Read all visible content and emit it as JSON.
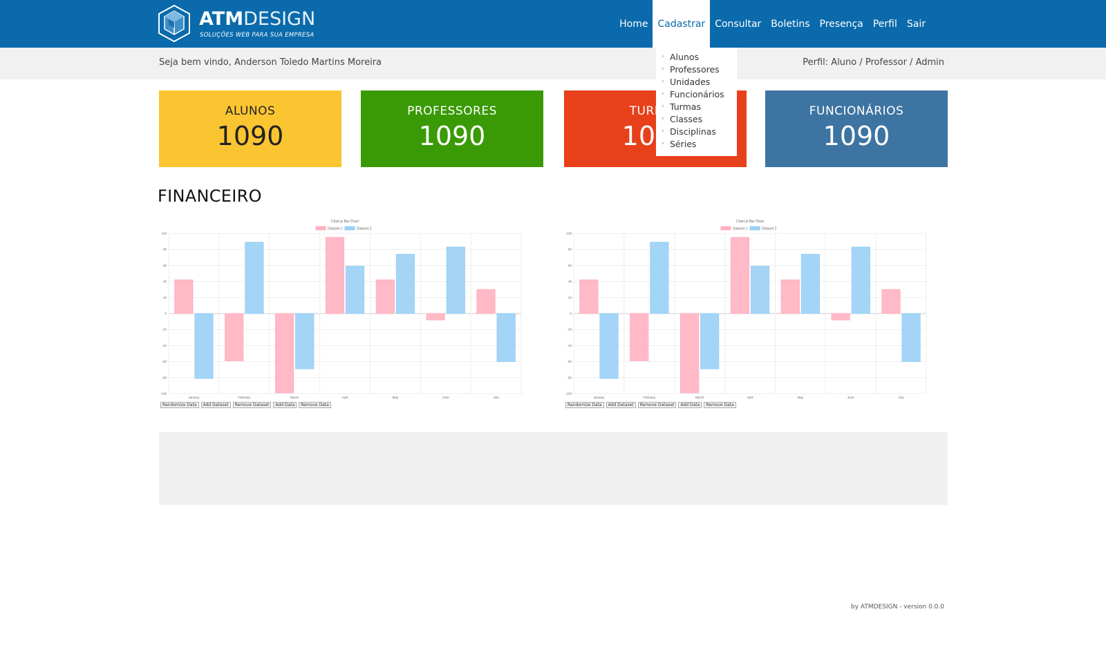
{
  "header": {
    "logo_bold": "ATM",
    "logo_light": "DESIGN",
    "logo_tagline": "SOLUÇÕES WEB PARA SUA EMPRESA",
    "nav": [
      {
        "label": "Home"
      },
      {
        "label": "Cadastrar"
      },
      {
        "label": "Consultar"
      },
      {
        "label": "Boletins"
      },
      {
        "label": "Presença"
      },
      {
        "label": "Perfil"
      },
      {
        "label": "Sair"
      }
    ],
    "colors": {
      "bar": "#0a6aab"
    }
  },
  "dropdown": {
    "items": [
      "Alunos",
      "Professores",
      "Unidades",
      "Funcionários",
      "Turmas",
      "Classes",
      "Disciplinas",
      "Séries"
    ]
  },
  "welcome": {
    "text": "Seja bem vindo, Anderson Toledo Martins Moreira",
    "profile": "Perfil: Aluno / Professor / Admin"
  },
  "cards": [
    {
      "label": "ALUNOS",
      "value": "1090",
      "color": "#fbc532"
    },
    {
      "label": "PROFESSORES",
      "value": "1090",
      "color": "#3a9a05"
    },
    {
      "label": "TURMAS",
      "value": "1090",
      "color": "#e8401a"
    },
    {
      "label": "FUNCIONÁRIOS",
      "value": "1090",
      "color": "#3e74a2"
    }
  ],
  "section_title": "FINANCEIRO",
  "chart_buttons": [
    "Randomize Data",
    "Add Dataset",
    "Remove Dataset",
    "Add Data",
    "Remove Data"
  ],
  "chart_data": [
    {
      "type": "bar",
      "title": "Chart.js Bar Chart",
      "categories": [
        "January",
        "February",
        "March",
        "April",
        "May",
        "June",
        "July"
      ],
      "series": [
        {
          "name": "Dataset 1",
          "color": "#ffb1c1",
          "values": [
            42,
            -59,
            -99,
            95,
            42,
            -8,
            30
          ]
        },
        {
          "name": "Dataset 2",
          "color": "#9ad0f5",
          "values": [
            -81,
            89,
            -69,
            59,
            74,
            83,
            -60
          ]
        }
      ],
      "ylim": [
        -100,
        100
      ],
      "yticks": [
        "100",
        "80",
        "60",
        "40",
        "20",
        "0",
        "-20",
        "-40",
        "-60",
        "-80",
        "-100"
      ],
      "legend": "top"
    },
    {
      "type": "bar",
      "title": "Chart.js Bar Chart",
      "categories": [
        "January",
        "February",
        "March",
        "April",
        "May",
        "June",
        "July"
      ],
      "series": [
        {
          "name": "Dataset 1",
          "color": "#ffb1c1",
          "values": [
            42,
            -59,
            -99,
            95,
            42,
            -8,
            30
          ]
        },
        {
          "name": "Dataset 2",
          "color": "#9ad0f5",
          "values": [
            -81,
            89,
            -69,
            59,
            74,
            83,
            -60
          ]
        }
      ],
      "ylim": [
        -100,
        100
      ],
      "yticks": [
        "100",
        "80",
        "60",
        "40",
        "20",
        "0",
        "-20",
        "-40",
        "-60",
        "-80",
        "-100"
      ],
      "legend": "top"
    }
  ],
  "footer": {
    "credits": "by ATMDESIGN - version 0.0.0"
  }
}
